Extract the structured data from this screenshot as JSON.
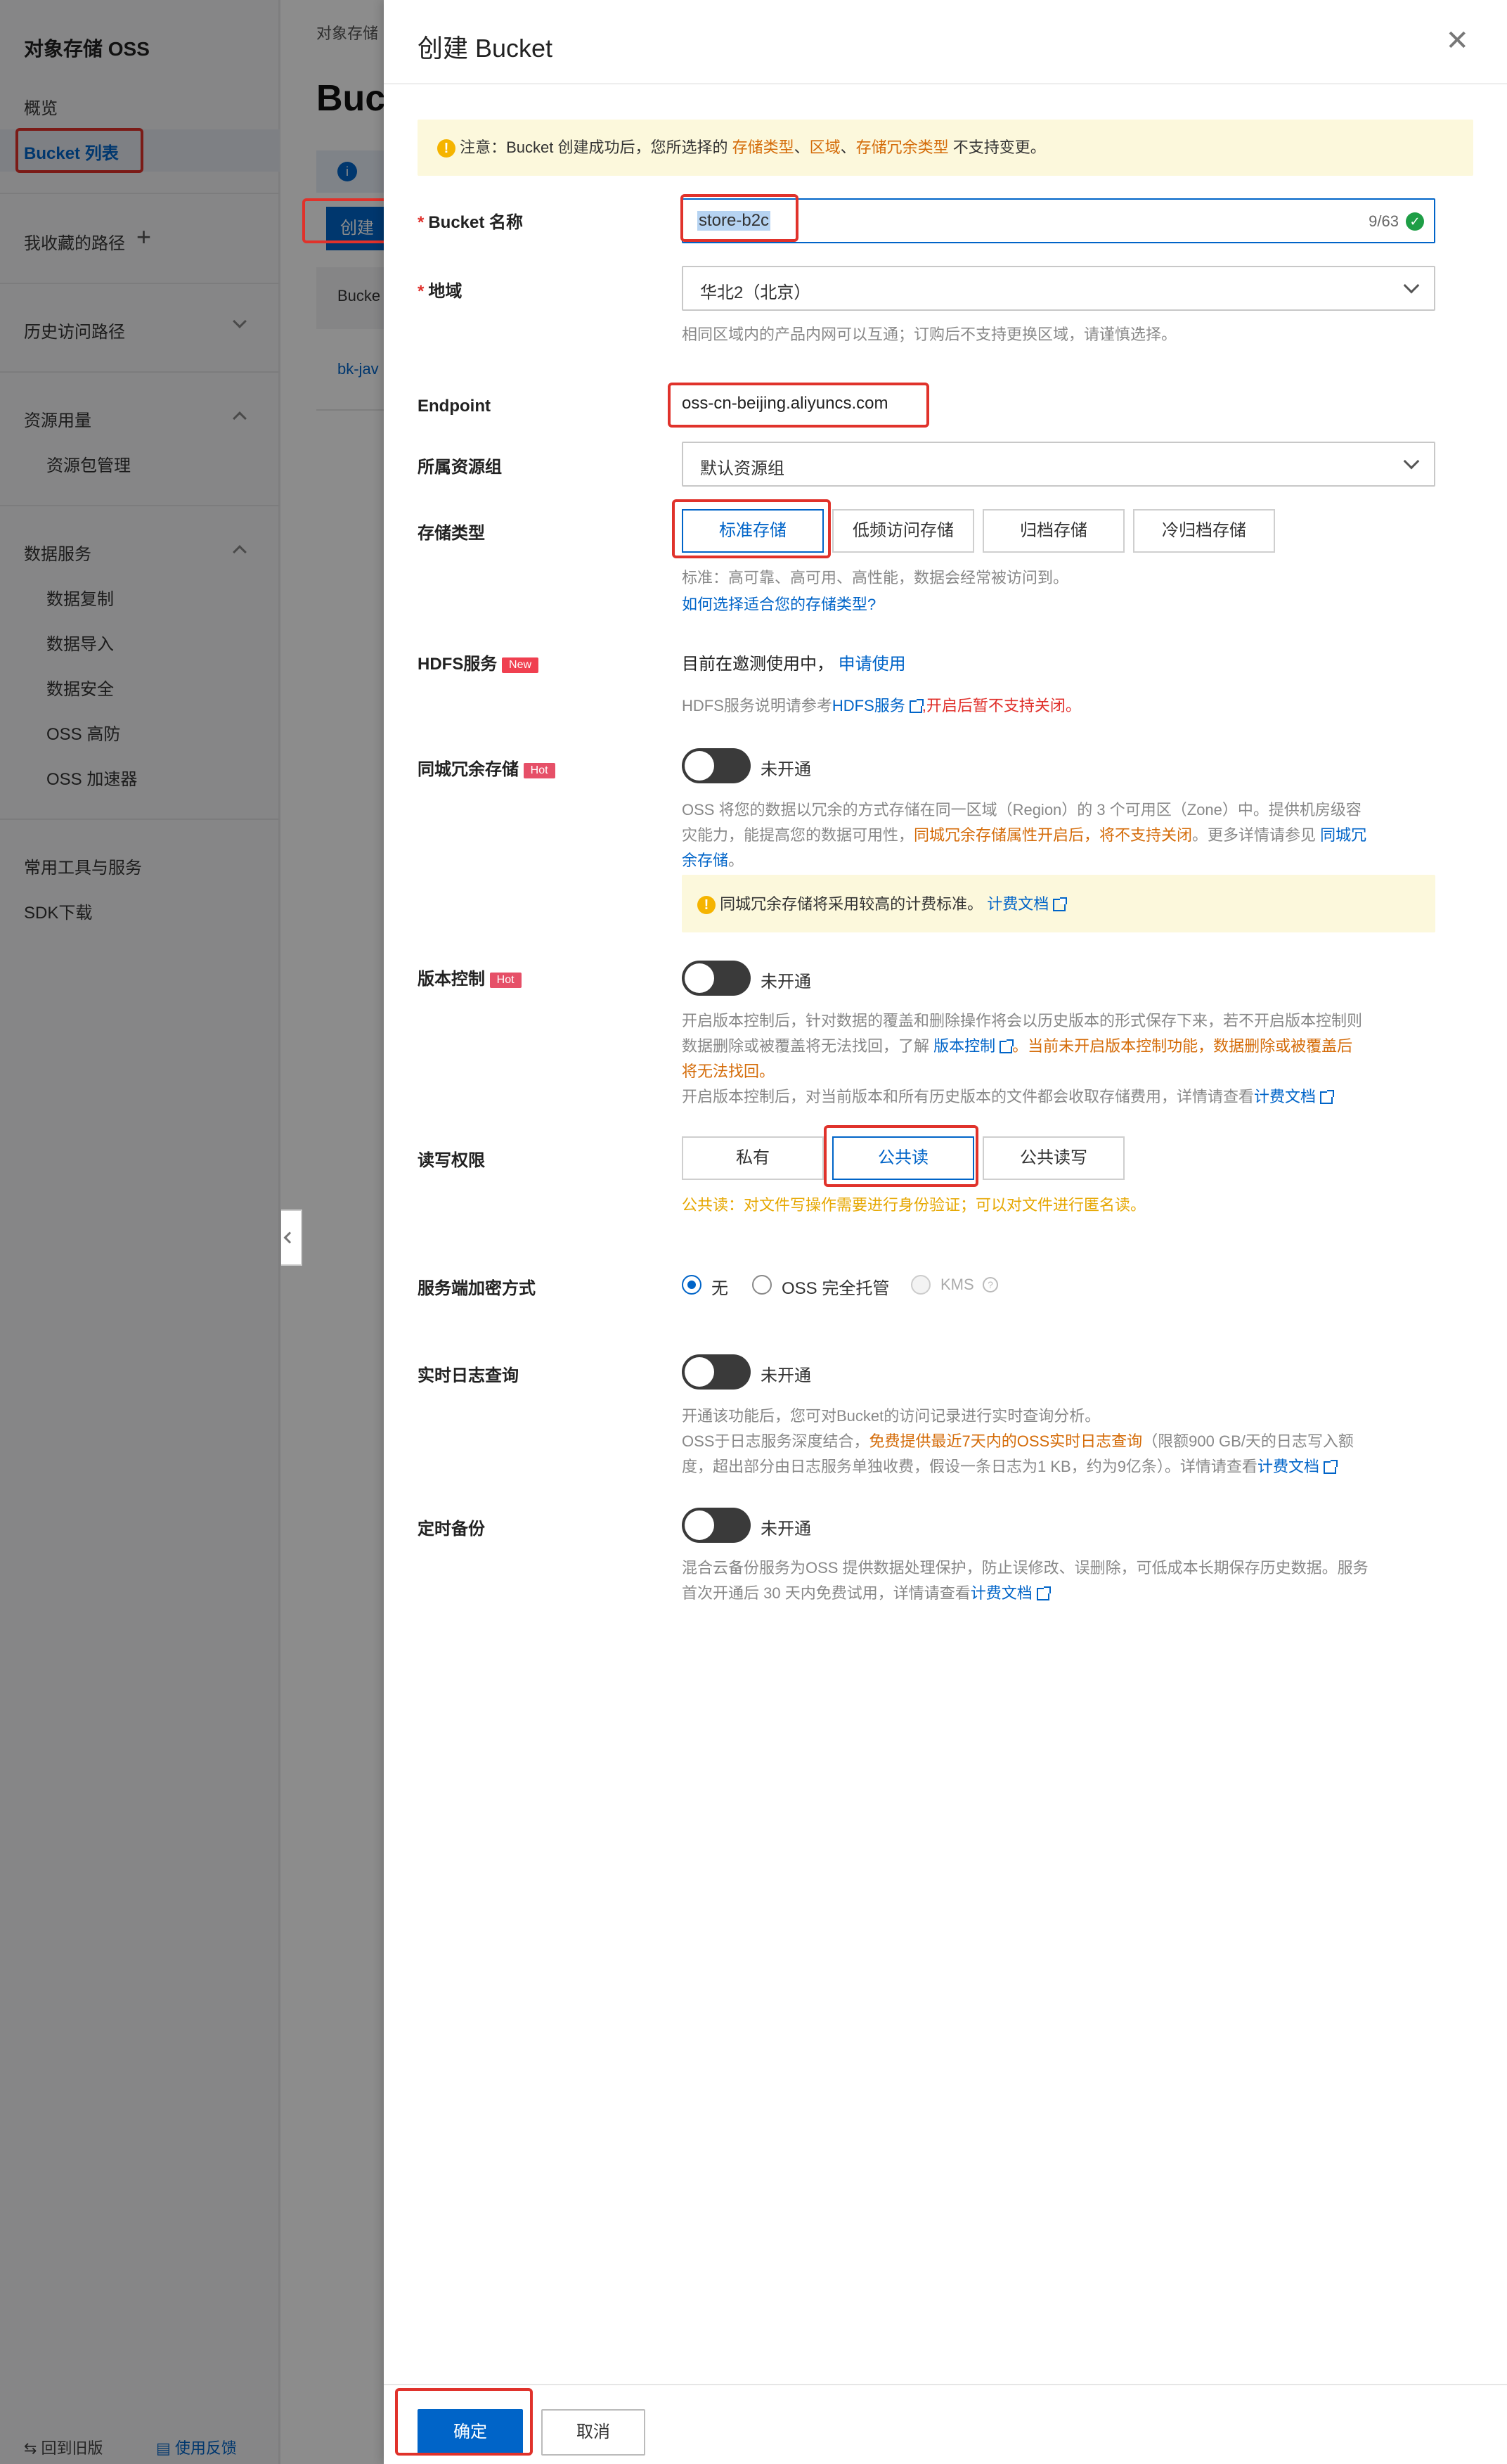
{
  "sidebar": {
    "title": "对象存储 OSS",
    "overview": "概览",
    "bucket_list": "Bucket 列表",
    "favorites": "我收藏的路径",
    "history": "历史访问路径",
    "usage": "资源用量",
    "usage_items": [
      "资源包管理"
    ],
    "data_services": "数据服务",
    "data_items": [
      "数据复制",
      "数据导入",
      "数据安全",
      "OSS 高防",
      "OSS 加速器"
    ],
    "tools": "常用工具与服务",
    "sdk": "SDK下载",
    "back_old": "回到旧版",
    "feedback": "使用反馈"
  },
  "background": {
    "breadcrumb": "对象存储",
    "heading": "Buc",
    "create_btn": "创建",
    "col_header": "Bucke",
    "row1": "bk-jav"
  },
  "drawer": {
    "title": "创建 Bucket",
    "notice_prefix": "注意：Bucket 创建成功后，您所选择的 ",
    "notice_storage_type": "存储类型",
    "notice_sep1": "、",
    "notice_region": "区域",
    "notice_sep2": "、",
    "notice_redundancy": "存储冗余类型",
    "notice_suffix": " 不支持变更。",
    "bucket_name_label": "Bucket 名称",
    "bucket_name_value": "store-b2c",
    "bucket_name_count": "9/63",
    "region_label": "地域",
    "region_value": "华北2（北京）",
    "region_help": "相同区域内的产品内网可以互通；订购后不支持更换区域，请谨慎选择。",
    "endpoint_label": "Endpoint",
    "endpoint_value": "oss-cn-beijing.aliyuncs.com",
    "resource_group_label": "所属资源组",
    "resource_group_value": "默认资源组",
    "storage_type_label": "存储类型",
    "storage_types": [
      "标准存储",
      "低频访问存储",
      "归档存储",
      "冷归档存储"
    ],
    "storage_help": "标准：高可靠、高可用、高性能，数据会经常被访问到。",
    "storage_help_link": "如何选择适合您的存储类型?",
    "hdfs_label": "HDFS服务",
    "hdfs_badge": "New",
    "hdfs_status": "目前在邀测使用中，",
    "hdfs_apply": "申请使用",
    "hdfs_help_prefix": "HDFS服务说明请参考",
    "hdfs_help_link": "HDFS服务",
    "hdfs_help_red": ",开启后暂不支持关闭。",
    "zrs_label": "同城冗余存储",
    "zrs_badge": "Hot",
    "zrs_toggle": "未开通",
    "zrs_help_1": "OSS 将您的数据以冗余的方式存储在同一区域（Region）的 3 个可用区（Zone）中。提供机房级容",
    "zrs_help_2_a": "灾能力，能提高您的数据可用性，",
    "zrs_help_2_b": "同城冗余存储属性开启后，",
    "zrs_help_2_c": "将不支持关闭",
    "zrs_help_2_d": "。更多详情请参见 ",
    "zrs_help_2_link": "同城冗",
    "zrs_help_3_link": "余存储",
    "zrs_help_3_end": "。",
    "zrs_notice": "同城冗余存储将采用较高的计费标准。",
    "zrs_notice_link": "计费文档",
    "versioning_label": "版本控制",
    "versioning_badge": "Hot",
    "versioning_toggle": "未开通",
    "versioning_help_1": "开启版本控制后，针对数据的覆盖和删除操作将会以历史版本的形式保存下来，若不开启版本控制则",
    "versioning_help_2_a": "数据删除或被覆盖将无法找回，了解 ",
    "versioning_help_2_link": "版本控制",
    "versioning_help_2_b": "。当前未开启版本控制功能，数据删除或被覆盖后",
    "versioning_help_3": "将无法找回。",
    "versioning_help_4": "开启版本控制后，对当前版本和所有历史版本的文件都会收取存储费用，详情请查看",
    "versioning_help_4_link": "计费文档",
    "acl_label": "读写权限",
    "acl_options": [
      "私有",
      "公共读",
      "公共读写"
    ],
    "acl_help": "公共读：对文件写操作需要进行身份验证；可以对文件进行匿名读。",
    "encryption_label": "服务端加密方式",
    "encryption_options": [
      "无",
      "OSS 完全托管",
      "KMS"
    ],
    "log_label": "实时日志查询",
    "log_toggle": "未开通",
    "log_help_1": "开通该功能后，您可对Bucket的访问记录进行实时查询分析。",
    "log_help_2_a": "OSS于日志服务深度结合，",
    "log_help_2_b": "免费提供最近7天内的OSS实时日志查询",
    "log_help_2_c": "（限额900 GB/天的日志写入额",
    "log_help_3": "度，超出部分由日志服务单独收费，假设一条日志为1 KB，约为9亿条）。详情请查看",
    "log_help_3_link": "计费文档",
    "backup_label": "定时备份",
    "backup_toggle": "未开通",
    "backup_help_1": "混合云备份服务为OSS 提供数据处理保护，防止误修改、误删除，可低成本长期保存历史数据。服务",
    "backup_help_2": "首次开通后 30 天内免费试用，详情请查看",
    "backup_help_2_link": "计费文档",
    "confirm": "确定",
    "cancel": "取消"
  }
}
